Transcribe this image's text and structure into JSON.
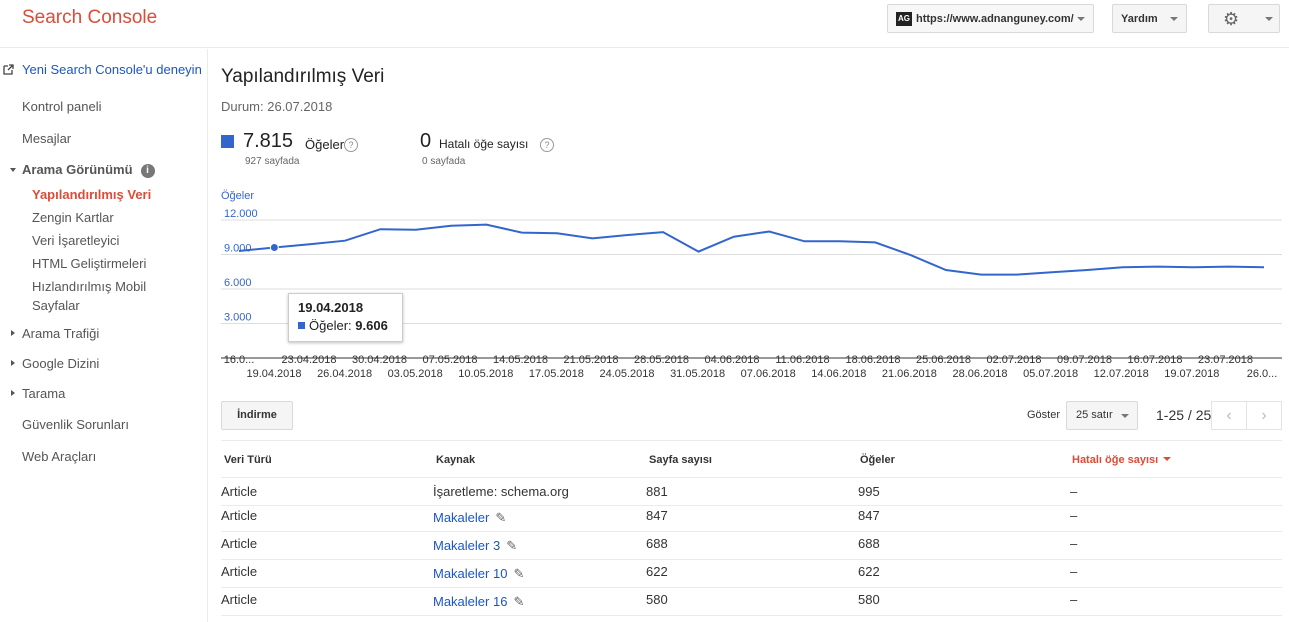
{
  "header": {
    "app_title": "Search Console",
    "site_url": "https://www.adnanguney.com/",
    "site_favicon_text": "AG",
    "help_label": "Yardım",
    "gear_icon": "gear-icon"
  },
  "sidebar": {
    "try_new": "Yeni Search Console'u deneyin",
    "dashboard": "Kontrol paneli",
    "messages": "Mesajlar",
    "search_appearance": "Arama Görünümü",
    "info_glyph": "i",
    "sub_items": [
      "Yapılandırılmış Veri",
      "Zengin Kartlar",
      "Veri İşaretleyici",
      "HTML Geliştirmeleri",
      "Hızlandırılmış Mobil",
      "Sayfalar"
    ],
    "search_traffic": "Arama Trafiği",
    "google_index": "Google Dizini",
    "crawl": "Tarama",
    "security": "Güvenlik Sorunları",
    "web_tools": "Web Araçları"
  },
  "main": {
    "title": "Yapılandırılmış Veri",
    "status": "Durum: 26.07.2018",
    "items_value": "7.815",
    "items_label": "Öğeler",
    "items_pages": "927 sayfada",
    "errors_value": "0",
    "errors_label": "Hatalı öğe sayısı",
    "errors_pages": "0 sayfada",
    "q_glyph": "?"
  },
  "chart_data": {
    "type": "line",
    "ylabel": "Öğeler",
    "ylim": [
      0,
      12000
    ],
    "yticks": [
      "12.000",
      "9.000",
      "6.000",
      "3.000"
    ],
    "grid": true,
    "x_top": [
      "16.0...",
      "23.04.2018",
      "30.04.2018",
      "07.05.2018",
      "14.05.2018",
      "21.05.2018",
      "28.05.2018",
      "04.06.2018",
      "11.06.2018",
      "18.06.2018",
      "25.06.2018",
      "02.07.2018",
      "09.07.2018",
      "16.07.2018",
      "23.07.2018"
    ],
    "x_bottom": [
      "19.04.2018",
      "26.04.2018",
      "03.05.2018",
      "10.05.2018",
      "17.05.2018",
      "24.05.2018",
      "31.05.2018",
      "07.06.2018",
      "14.06.2018",
      "21.06.2018",
      "28.06.2018",
      "05.07.2018",
      "12.07.2018",
      "19.07.2018",
      "26.0..."
    ],
    "series": [
      {
        "name": "Öğeler",
        "color": "#3366cc",
        "x": [
          "16.04.2018",
          "19.04.2018",
          "23.04.2018",
          "26.04.2018",
          "30.04.2018",
          "03.05.2018",
          "07.05.2018",
          "10.05.2018",
          "14.05.2018",
          "17.05.2018",
          "21.05.2018",
          "24.05.2018",
          "28.05.2018",
          "31.05.2018",
          "04.06.2018",
          "07.06.2018",
          "11.06.2018",
          "14.06.2018",
          "18.06.2018",
          "21.06.2018",
          "25.06.2018",
          "28.06.2018",
          "02.07.2018",
          "05.07.2018",
          "09.07.2018",
          "12.07.2018",
          "16.07.2018",
          "19.07.2018",
          "23.07.2018",
          "26.07.2018"
        ],
        "values": [
          9300,
          9606,
          9900,
          10200,
          11200,
          11150,
          11500,
          11600,
          10900,
          10850,
          10400,
          10700,
          10950,
          9250,
          10550,
          11000,
          10150,
          10150,
          10050,
          8950,
          7650,
          7250,
          7250,
          7450,
          7650,
          7900,
          7950,
          7900,
          7950,
          7900
        ]
      }
    ],
    "tooltip": {
      "date": "19.04.2018",
      "label": "Öğeler:",
      "value": "9.606"
    }
  },
  "toolbar": {
    "download_label": "İndirme",
    "show_label": "Göster",
    "rows_option": "25 satır",
    "pager_text": "1-25 / 25",
    "prev_glyph": "‹",
    "next_glyph": "›"
  },
  "table": {
    "headers": [
      "Veri Türü",
      "Kaynak",
      "Sayfa sayısı",
      "Öğeler",
      "Hatalı öğe sayısı"
    ],
    "edit_glyph": "✎",
    "rows": [
      {
        "type": "Article",
        "source": "İşaretleme: schema.org",
        "source_link": false,
        "pages": "881",
        "items": "995",
        "errors": "–"
      },
      {
        "type": "Article",
        "source": "Makaleler",
        "source_link": true,
        "pages": "847",
        "items": "847",
        "errors": "–"
      },
      {
        "type": "Article",
        "source": "Makaleler 3",
        "source_link": true,
        "pages": "688",
        "items": "688",
        "errors": "–"
      },
      {
        "type": "Article",
        "source": "Makaleler 10",
        "source_link": true,
        "pages": "622",
        "items": "622",
        "errors": "–"
      },
      {
        "type": "Article",
        "source": "Makaleler 16",
        "source_link": true,
        "pages": "580",
        "items": "580",
        "errors": "–"
      }
    ]
  }
}
